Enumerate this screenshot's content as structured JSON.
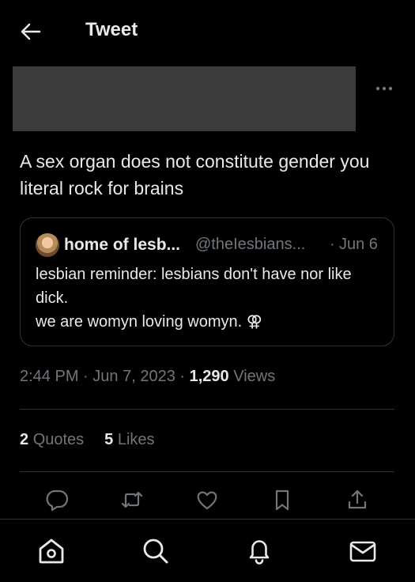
{
  "header": {
    "title": "Tweet",
    "back_icon": "back-arrow-icon"
  },
  "post": {
    "more_icon": "more-horizontal-icon",
    "text": "A sex organ does not constitute gender you literal rock for brains"
  },
  "quote": {
    "author_name": "home of lesb...",
    "handle": "@theIesbians...",
    "separator": "·",
    "date": "Jun 6",
    "lines": [
      "lesbian reminder: lesbians don't have nor like dick.",
      "we are womyn loving womyn. ⚢"
    ]
  },
  "meta": {
    "time": "2:44 PM",
    "sep1": "·",
    "date": "Jun 7, 2023",
    "sep2": "·",
    "views_count": "1,290",
    "views_label": "Views"
  },
  "stats": {
    "quotes_count": "2",
    "quotes_label": "Quotes",
    "likes_count": "5",
    "likes_label": "Likes"
  },
  "actions": [
    "reply-icon",
    "retweet-icon",
    "like-icon",
    "bookmark-icon",
    "share-icon"
  ],
  "tabbar": [
    "home-icon",
    "search-icon",
    "notifications-icon",
    "messages-icon"
  ],
  "colors": {
    "background": "#000000",
    "text": "#e7e9ea",
    "secondary": "#71767b",
    "border": "#2f3336"
  }
}
